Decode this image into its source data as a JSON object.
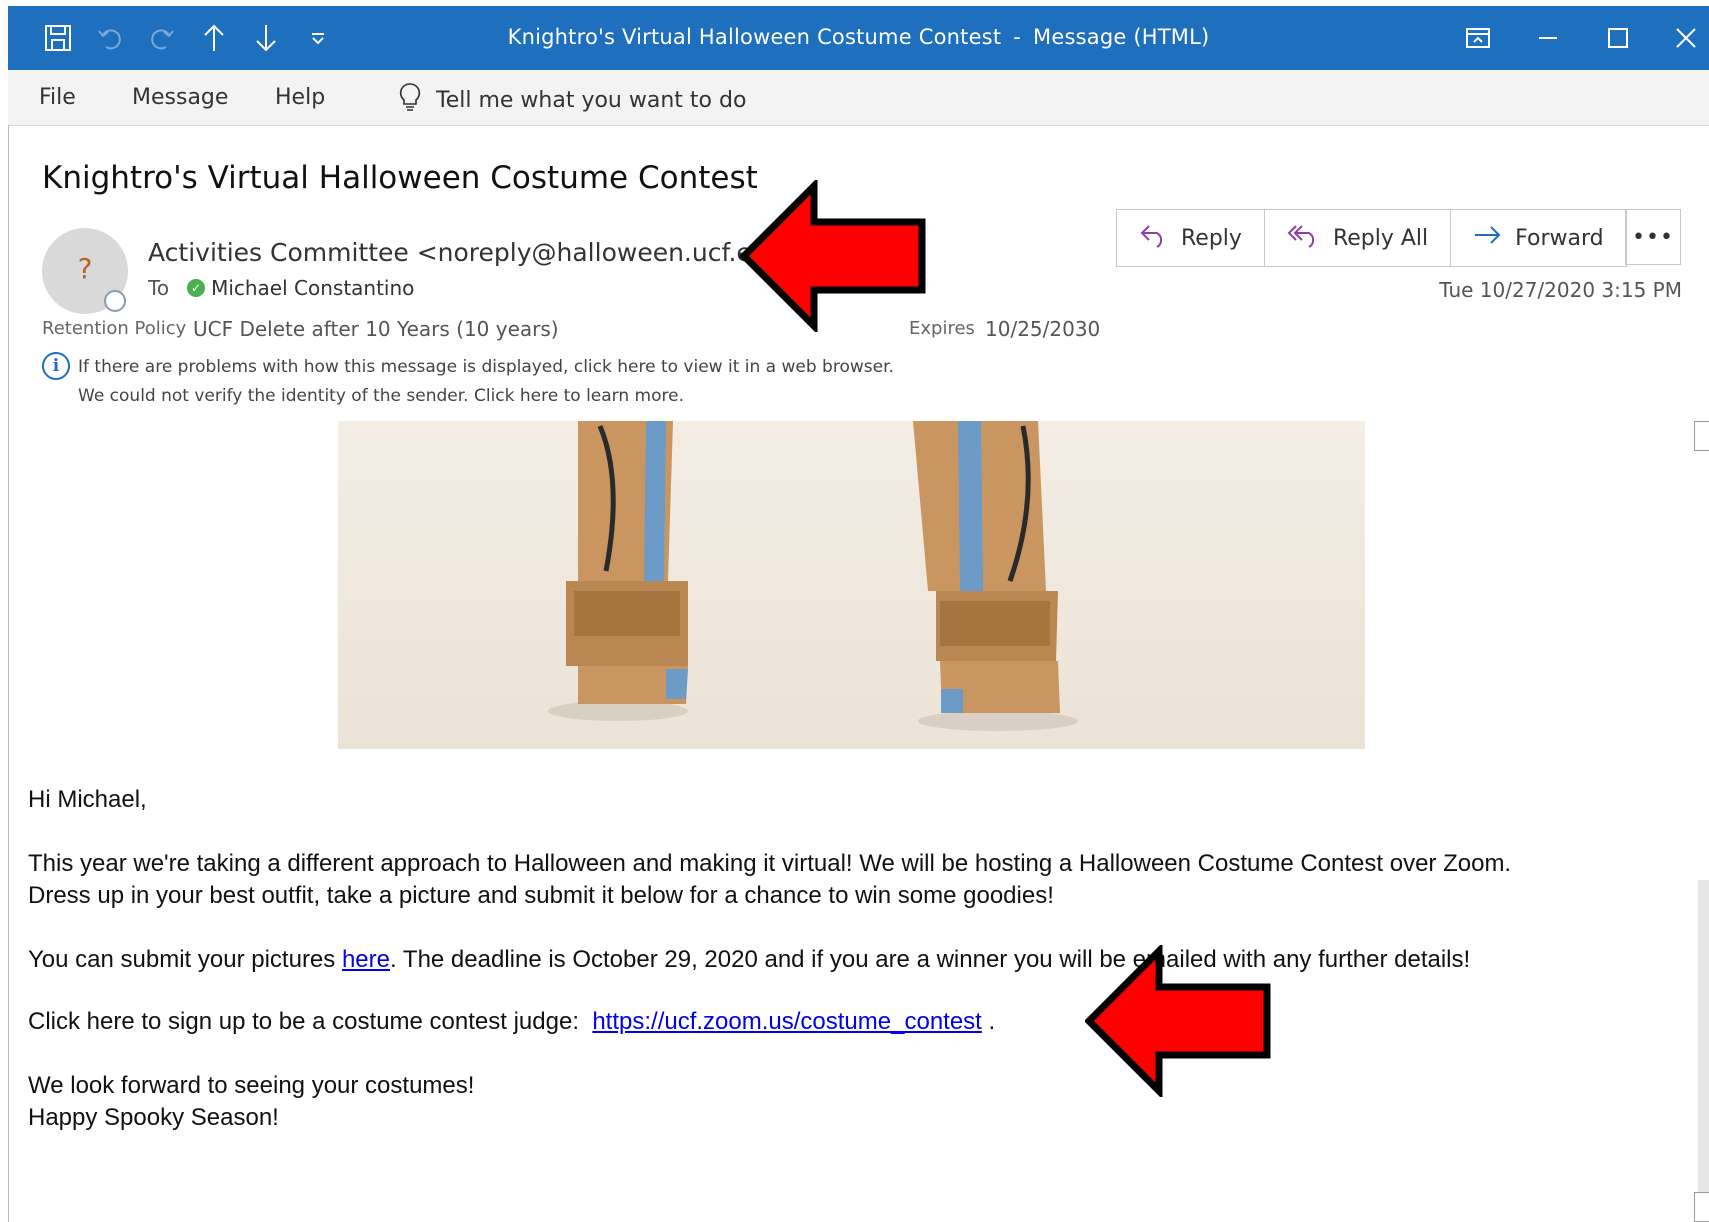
{
  "window": {
    "title": "Knightro's Virtual Halloween Costume Contest",
    "separator": "-",
    "mode": "Message (HTML)"
  },
  "menu": {
    "file": "File",
    "message": "Message",
    "help": "Help",
    "tell_me": "Tell me what you want to do"
  },
  "message": {
    "subject": "Knightro's Virtual Halloween Costume Contest",
    "avatar_initial": "?",
    "sender": "Activities Committee <noreply@halloween.ucf.eu>",
    "to_label": "To",
    "recipient": "Michael Constantino",
    "date": "Tue 10/27/2020 3:15 PM",
    "retention_label": "Retention Policy",
    "retention_value": "UCF Delete after 10 Years (10 years)",
    "expires_label": "Expires",
    "expires_value": "10/25/2030",
    "info_line1": "If there are problems with how this message is displayed, click here to view it in a web browser.",
    "info_line2": "We could not verify the identity of the sender. Click here to learn more."
  },
  "actions": {
    "reply": "Reply",
    "reply_all": "Reply All",
    "forward": "Forward",
    "more": "•••"
  },
  "body": {
    "greeting": "Hi Michael,",
    "para1_line1": "This year we're taking a different approach to Halloween and making it virtual! We will be hosting a Halloween Costume Contest over Zoom.",
    "para1_line2": "Dress up in your best outfit, take a picture and submit it below for a chance to win some goodies!",
    "para2_pre": "You can submit your pictures ",
    "para2_link": "here",
    "para2_post": ". The deadline is October 29, 2020 and if you are a winner you will be emailed with any further details!",
    "para3_pre": "Click here to sign up to be a costume contest judge:  ",
    "para3_link": "https://ucf.zoom.us/costume_contest",
    "para3_post": " .",
    "closing1": "We look forward to seeing your costumes!",
    "closing2": "Happy Spooky Season!"
  },
  "icons": {
    "save": "save-icon",
    "undo": "undo-icon",
    "redo": "redo-icon",
    "up": "arrow-up-icon",
    "down": "arrow-down-icon",
    "customize": "customize-toolbar-icon",
    "lightbulb": "lightbulb-icon",
    "info": "info-icon"
  },
  "colors": {
    "titlebar": "#1e6fbd",
    "annotation_arrow": "#ff0000",
    "reply_all_icon": "#8e3ea1",
    "forward_icon": "#1e6fbd"
  }
}
